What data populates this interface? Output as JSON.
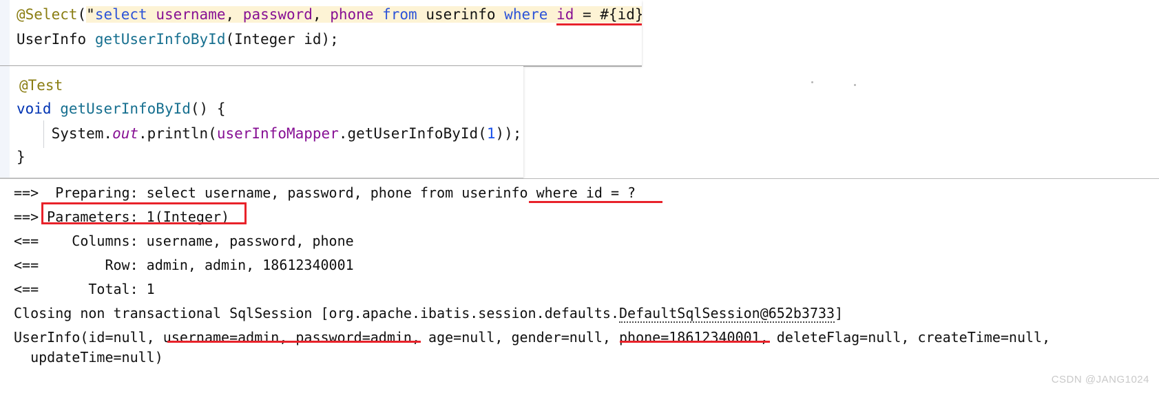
{
  "editor_select": {
    "line1": {
      "annotation": "@Select",
      "open_paren": "(",
      "quote_open": "\"",
      "sql": {
        "select": "select",
        "col_username": "username",
        "comma1": ", ",
        "col_password": "password",
        "comma2": ", ",
        "col_phone": "phone",
        "space1": " ",
        "from": "from",
        "space2": " ",
        "table": "userinfo",
        "space3": " ",
        "where": "where",
        "space4": " ",
        "id_col": "id",
        "eq": " = ",
        "placeholder": "#{id}"
      },
      "quote_close": "\"",
      "close_paren": ")"
    },
    "line2": {
      "return_type": "UserInfo",
      "space": " ",
      "method": "getUserInfoById",
      "params": "(Integer id);"
    }
  },
  "editor_test": {
    "line1": "@Test",
    "line2": {
      "keyword": "void",
      "space": " ",
      "method": "getUserInfoById",
      "tail": "() {"
    },
    "line3": {
      "indent": "    ",
      "system": "System.",
      "out": "out",
      "println": ".println(",
      "mapper": "userInfoMapper",
      "dot": ".",
      "call": "getUserInfoById",
      "paren_open": "(",
      "arg": "1",
      "tail": "));"
    },
    "line4": "}"
  },
  "console": {
    "lines": [
      "==>  Preparing: select username, password, phone from userinfo where id = ?",
      "==> Parameters: 1(Integer)",
      "<==    Columns: username, password, phone",
      "<==        Row: admin, admin, 18612340001",
      "<==      Total: 1"
    ],
    "closing_line": {
      "prefix": "Closing non transactional SqlSession [org.apache.ibatis.session.defaults.",
      "session_ref": "DefaultSqlSession@652b3733",
      "suffix": "]"
    },
    "userinfo_line_1": "UserInfo(id=null, username=admin, password=admin, age=null, gender=null, phone=18612340001, deleteFlag=null, createTime=null,",
    "userinfo_line_2": "  updateTime=null)"
  },
  "annotations": {
    "box_parameters_label": "Parameters: 1(Integer)",
    "underline_where_label": "where id = ?",
    "underline_userpass_label": "username=admin, password=admin",
    "underline_phone_label": "phone=18612340001",
    "accent_color": "#e8222a"
  },
  "watermark": {
    "text": "CSDN @JANG1024"
  }
}
